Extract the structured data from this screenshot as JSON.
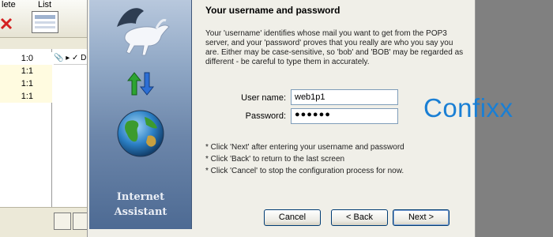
{
  "background_app": {
    "toolbar": {
      "delete_label": "lete",
      "list_label": "List"
    },
    "list_rows": [
      "1:0",
      "1:1",
      "1:1",
      "1:1"
    ],
    "subpane_header": "📎 ▸ ✓ D"
  },
  "wizard": {
    "side_title_line1": "Internet",
    "side_title_line2": "Assistant",
    "heading": "Your username and password",
    "description": "Your 'username' identifies whose mail you want to get from the POP3 server, and your 'password' proves that you really are who you say you are. Either may be case-sensitive, so 'bob' and 'BOB' may be regarded as different - be careful to type them in accurately.",
    "username_label": "User name:",
    "username_value": "web1p1",
    "password_label": "Password:",
    "password_value": "●●●●●●",
    "hints": [
      "* Click 'Next' after entering your username and password",
      "* Click 'Back' to return to the last screen",
      "* Click 'Cancel' to stop the configuration process for now."
    ],
    "buttons": {
      "cancel": "Cancel",
      "back": "< Back",
      "next": "Next >"
    }
  },
  "logo": {
    "text": "Confixx",
    "color": "#1a7fd4"
  }
}
